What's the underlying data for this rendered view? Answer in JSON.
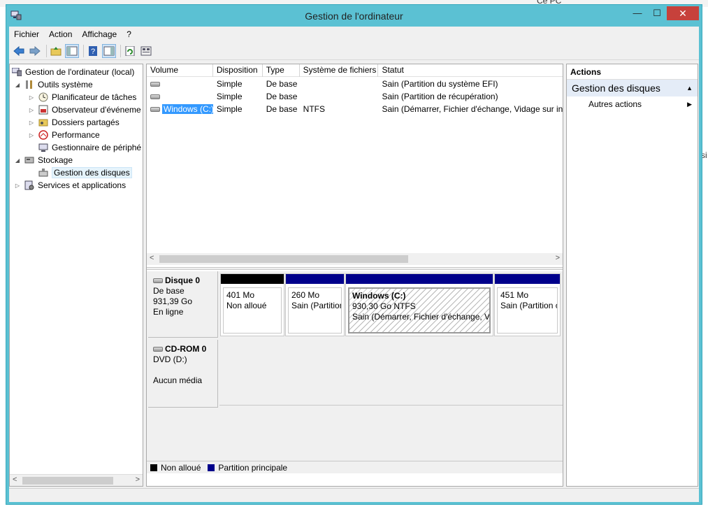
{
  "background": {
    "top_right_text": "Ce PC",
    "right_edge_text": "si"
  },
  "window": {
    "title": "Gestion de l'ordinateur",
    "minimize": "—",
    "maximize": "☐",
    "close": "✕"
  },
  "menu": [
    "Fichier",
    "Action",
    "Affichage",
    "?"
  ],
  "tree": {
    "items": [
      {
        "label": "Gestion de l'ordinateur (local)",
        "icon": "computer-icon"
      },
      {
        "label": "Outils système",
        "icon": "tools-icon"
      },
      {
        "label": "Planificateur de tâches",
        "icon": "clock-icon"
      },
      {
        "label": "Observateur d'événeme",
        "icon": "event-viewer-icon"
      },
      {
        "label": "Dossiers partagés",
        "icon": "shared-folder-icon"
      },
      {
        "label": "Performance",
        "icon": "performance-icon"
      },
      {
        "label": "Gestionnaire de périphé",
        "icon": "device-manager-icon"
      },
      {
        "label": "Stockage",
        "icon": "storage-icon"
      },
      {
        "label": "Gestion des disques",
        "icon": "disk-management-icon"
      },
      {
        "label": "Services et applications",
        "icon": "services-icon"
      }
    ]
  },
  "volumes": {
    "headers": [
      "Volume",
      "Disposition",
      "Type",
      "Système de fichiers",
      "Statut"
    ],
    "rows": [
      {
        "volume": "",
        "layout": "Simple",
        "type": "De base",
        "fs": "",
        "status": "Sain (Partition du système EFI)"
      },
      {
        "volume": "",
        "layout": "Simple",
        "type": "De base",
        "fs": "",
        "status": "Sain (Partition de récupération)"
      },
      {
        "volume": "Windows (C:)",
        "layout": "Simple",
        "type": "De base",
        "fs": "NTFS",
        "status": "Sain (Démarrer, Fichier d'échange, Vidage sur inc"
      }
    ]
  },
  "disks": {
    "disk0": {
      "name": "Disque 0",
      "type": "De base",
      "size": "931,39 Go",
      "state": "En ligne",
      "partitions": [
        {
          "line1": "401 Mo",
          "line2": "Non alloué",
          "bar_color": "#000000"
        },
        {
          "line1": "260 Mo",
          "line2": "Sain (Partition",
          "bar_color": "#00008b"
        },
        {
          "title": "Windows  (C:)",
          "line1": "930,30 Go NTFS",
          "line2": "Sain (Démarrer, Fichier d'échange, Vic",
          "bar_color": "#00008b"
        },
        {
          "line1": "451 Mo",
          "line2": "Sain (Partition c",
          "bar_color": "#00008b"
        }
      ]
    },
    "cdrom": {
      "name": "CD-ROM 0",
      "drive": "DVD (D:)",
      "media": "Aucun média"
    }
  },
  "legend": [
    {
      "label": "Non alloué",
      "color": "#000000"
    },
    {
      "label": "Partition principale",
      "color": "#00008b"
    }
  ],
  "actions": {
    "title": "Actions",
    "group": "Gestion des disques",
    "items": [
      "Autres actions"
    ]
  }
}
